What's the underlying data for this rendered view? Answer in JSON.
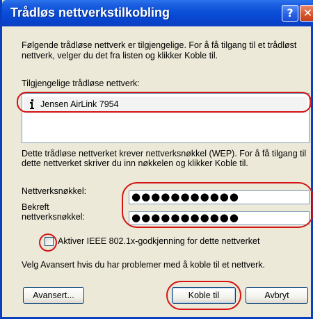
{
  "window": {
    "title": "Trådløs nettverkstilkobling",
    "help_button": "?",
    "close_button": "✕"
  },
  "intro_text": "Følgende trådløse nettverk er tilgjengelige. For å få tilgang til et trådløst nettverk, velger du det fra listen og klikker Koble til.",
  "networks_label": "Tilgjengelige trådløse nettverk:",
  "networks": [
    {
      "name": "Jensen AirLink 7954",
      "icon": "wireless-network-icon"
    }
  ],
  "wep_text": "Dette trådløse nettverket krever nettverksnøkkel (WEP). For å få tilgang til dette nettverket skriver du inn nøkkelen og klikker Koble til.",
  "key_label": "Nettverksnøkkel:",
  "key_value": "●●●●●●●●●●●",
  "confirm_label": "Bekreft nettverksnøkkel:",
  "confirm_value": "●●●●●●●●●●●",
  "ieee_checkbox_label": "Aktiver IEEE 802.1x-godkjenning for dette nettverket",
  "ieee_checkbox_checked": false,
  "advanced_hint": "Velg Avansert hvis du har problemer med å koble til et nettverk.",
  "buttons": {
    "advanced": "Avansert...",
    "connect": "Koble til",
    "cancel": "Avbryt"
  },
  "colors": {
    "titlebar": "#0a4fd8",
    "dialog_bg": "#ece9d8",
    "annotation_ring": "#d41313"
  }
}
